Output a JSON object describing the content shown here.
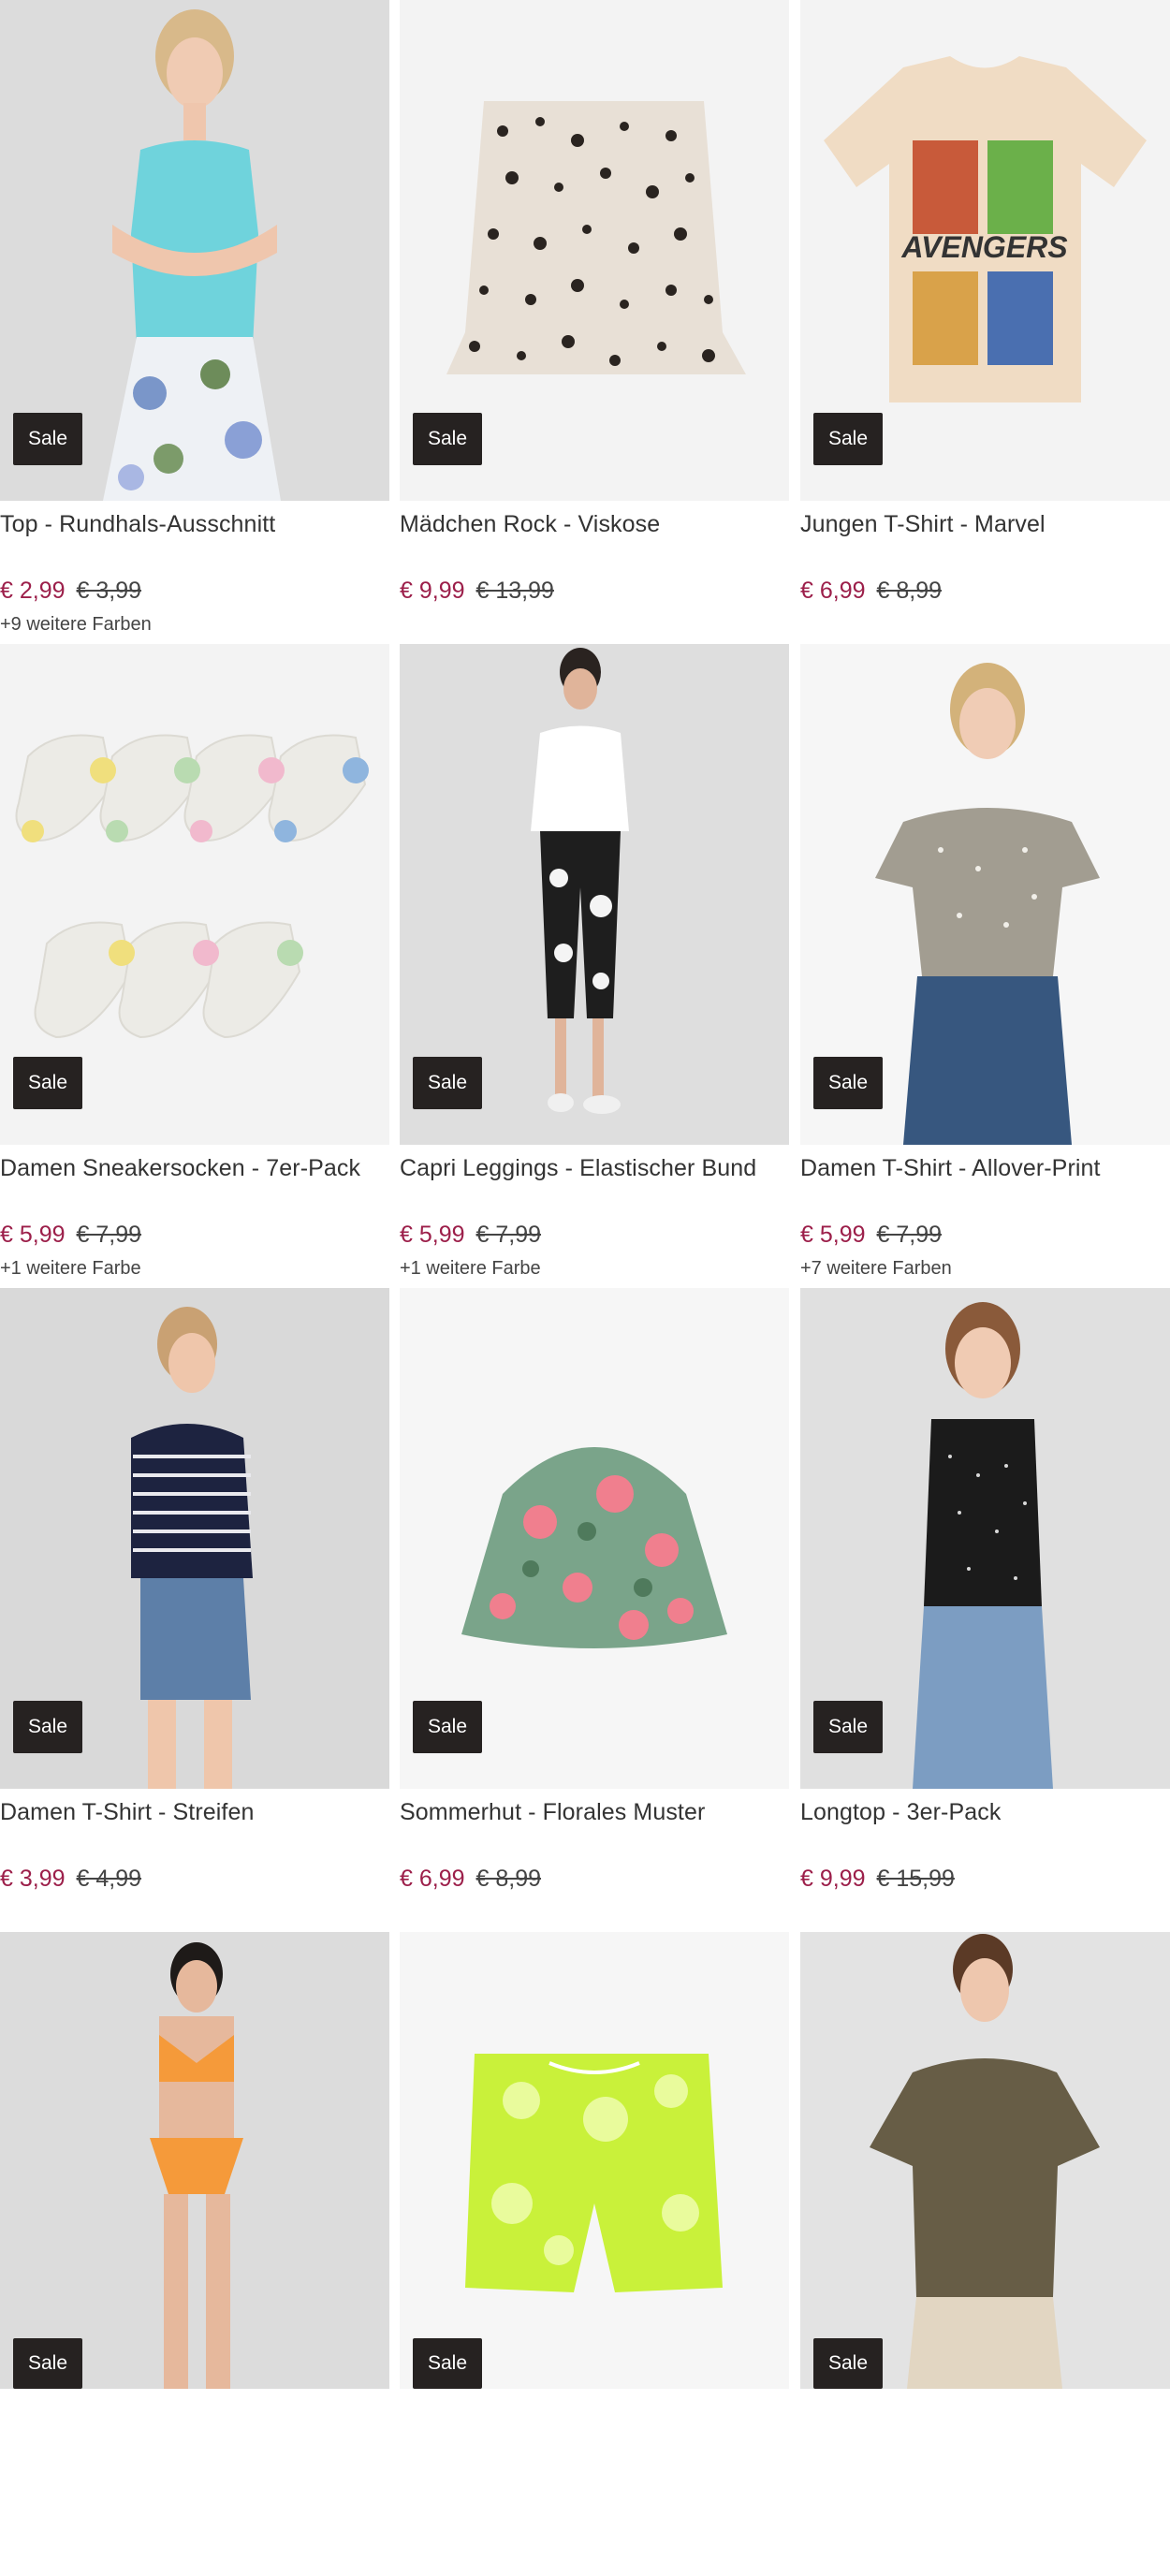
{
  "products": [
    {
      "title": "Top - Rundhals-Ausschnitt",
      "badge": "Sale",
      "price": "€ 2,99",
      "old_price": "€ 3,99",
      "colors": "+9 weitere Farben"
    },
    {
      "title": "Mädchen Rock - Viskose",
      "badge": "Sale",
      "price": "€ 9,99",
      "old_price": "€ 13,99",
      "colors": ""
    },
    {
      "title": "Jungen T-Shirt - Marvel",
      "badge": "Sale",
      "price": "€ 6,99",
      "old_price": "€ 8,99",
      "colors": "",
      "print_text": "AVENGERS"
    },
    {
      "title": "Damen Sneakersocken - 7er-Pack",
      "badge": "Sale",
      "price": "€ 5,99",
      "old_price": "€ 7,99",
      "colors": "+1 weitere Farbe"
    },
    {
      "title": "Capri Leggings - Elastischer Bund",
      "badge": "Sale",
      "price": "€ 5,99",
      "old_price": "€ 7,99",
      "colors": "+1 weitere Farbe"
    },
    {
      "title": "Damen T-Shirt - Allover-Print",
      "badge": "Sale",
      "price": "€ 5,99",
      "old_price": "€ 7,99",
      "colors": "+7 weitere Farben"
    },
    {
      "title": "Damen T-Shirt - Streifen",
      "badge": "Sale",
      "price": "€ 3,99",
      "old_price": "€ 4,99",
      "colors": ""
    },
    {
      "title": "Sommerhut - Florales Muster",
      "badge": "Sale",
      "price": "€ 6,99",
      "old_price": "€ 8,99",
      "colors": ""
    },
    {
      "title": "Longtop - 3er-Pack",
      "badge": "Sale",
      "price": "€ 9,99",
      "old_price": "€ 15,99",
      "colors": ""
    },
    {
      "title": "",
      "badge": "Sale",
      "price": "",
      "old_price": "",
      "colors": ""
    },
    {
      "title": "",
      "badge": "Sale",
      "price": "",
      "old_price": "",
      "colors": ""
    },
    {
      "title": "",
      "badge": "Sale",
      "price": "",
      "old_price": "",
      "colors": ""
    }
  ],
  "colors": {
    "price": "#9c1f4a",
    "badge_bg": "#262221",
    "badge_text": "#ffffff"
  }
}
